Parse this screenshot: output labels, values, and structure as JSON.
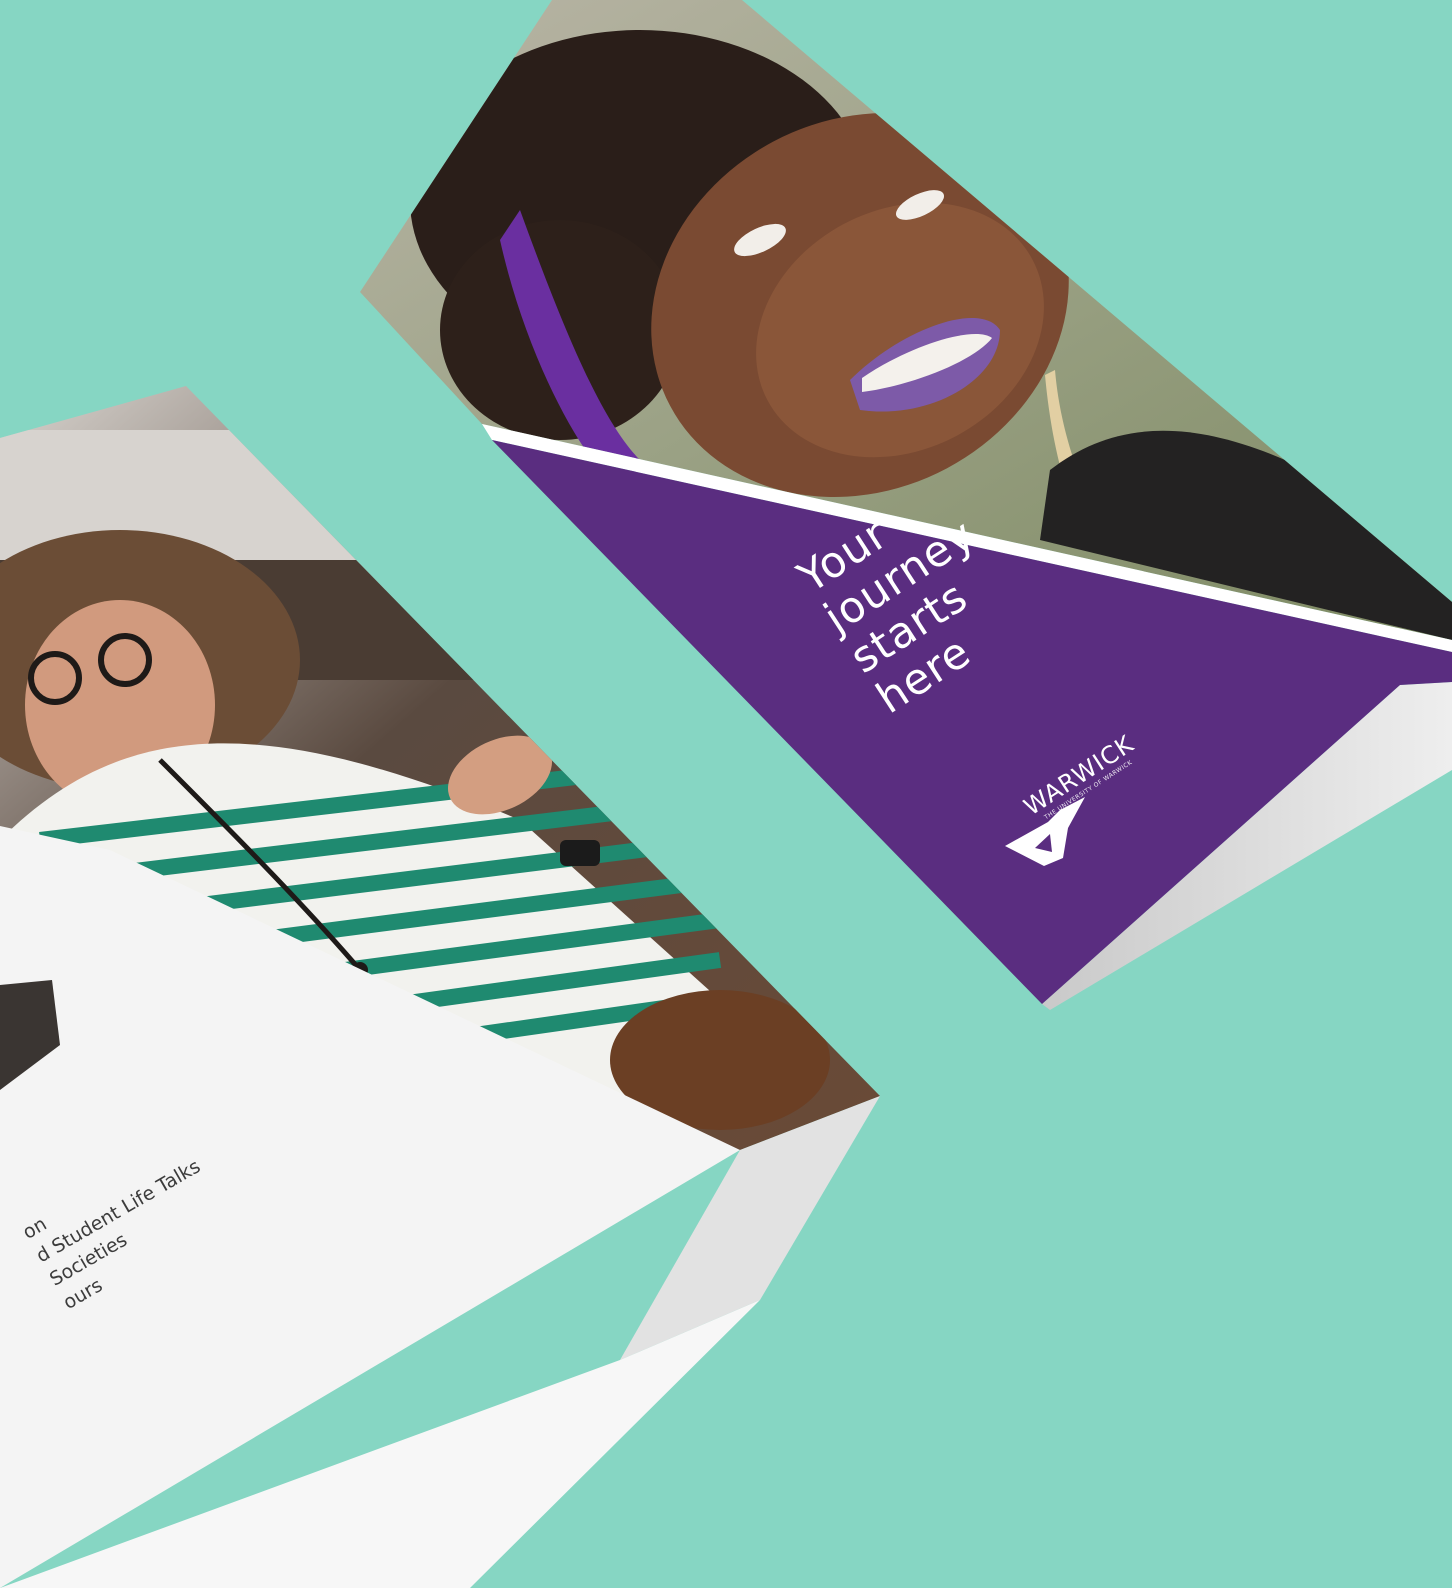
{
  "cover": {
    "headline_lines": [
      "Your",
      "journey",
      "starts",
      "here"
    ],
    "logo_word": "WARWICK",
    "logo_subtitle": "THE UNIVERSITY OF WARWICK"
  },
  "inside": {
    "list_lines": [
      "on",
      "d Student Life Talks",
      "Societies",
      "ours"
    ]
  },
  "colors": {
    "background": "#86d6c3",
    "cover_purple": "#5a2d80",
    "paper": "#f4f4f4",
    "headband": "#6a2fa0",
    "stripe_green": "#1f8a70"
  }
}
